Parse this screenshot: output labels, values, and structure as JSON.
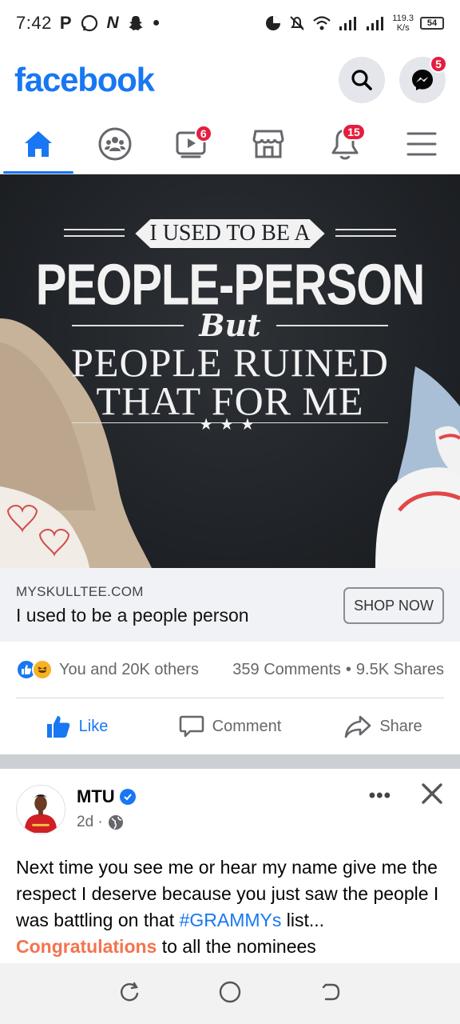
{
  "status_bar": {
    "time": "7:42",
    "left_icons": [
      "p-icon",
      "whatsapp-icon",
      "n-icon",
      "snapchat-icon",
      "dot-icon"
    ],
    "speed_value": "119.3",
    "speed_unit": "K/s",
    "battery": "54"
  },
  "header": {
    "logo": "facebook",
    "messenger_badge": "5"
  },
  "nav_tabs": [
    {
      "name": "home",
      "badge": ""
    },
    {
      "name": "groups",
      "badge": ""
    },
    {
      "name": "watch",
      "badge": "6"
    },
    {
      "name": "marketplace",
      "badge": ""
    },
    {
      "name": "notifications",
      "badge": "15"
    },
    {
      "name": "menu",
      "badge": ""
    }
  ],
  "ad": {
    "image_text": {
      "line1": "I USED TO BE A",
      "line2": "PEOPLE-PERSON",
      "line3": "But",
      "line4": "PEOPLE RUINED",
      "line5": "THAT FOR ME",
      "stars": "★★★"
    },
    "domain": "MYSKULLTEE.COM",
    "title": "I used to be a people person",
    "cta": "SHOP NOW"
  },
  "reactions": {
    "summary": "You and 20K others",
    "comments": "359 Comments",
    "dot": "•",
    "shares": "9.5K Shares"
  },
  "actions": {
    "like": "Like",
    "comment": "Comment",
    "share": "Share"
  },
  "post": {
    "author": "MTU",
    "time": "2d ·",
    "menu": "•••",
    "body_before": "Next time you see me or hear my name give me the respect I deserve because you just saw the people I was battling on that ",
    "hashtag": "#GRAMMYs",
    "body_mid": " list... ",
    "highlight": "Congratulations",
    "body_after": " to all the nominees"
  },
  "colors": {
    "brand": "#1877f2",
    "badge": "#e41e3f",
    "highlight": "#f4734e"
  }
}
